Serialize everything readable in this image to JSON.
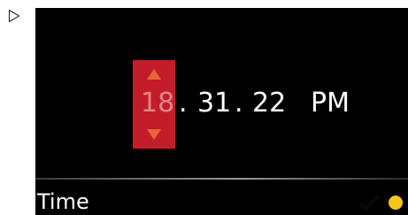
{
  "clock": {
    "hour": "18",
    "sep_1": ".",
    "minute": "31",
    "sep_2": ".",
    "second": "22",
    "ampm": "PM"
  },
  "footer": {
    "label": "Time"
  },
  "icons": {
    "marker": "play-outline-icon",
    "spinner_up": "triangle-up-icon",
    "spinner_down": "triangle-down-icon",
    "confirm": "check-icon",
    "status": "status-dot-icon"
  },
  "colors": {
    "screen_bg": "#000000",
    "spinner_bg": "#c41d2a",
    "spinner_arrow": "#e8653a",
    "active_digit": "#e48484",
    "text": "#ffffff",
    "status_dot": "#f5c518"
  }
}
